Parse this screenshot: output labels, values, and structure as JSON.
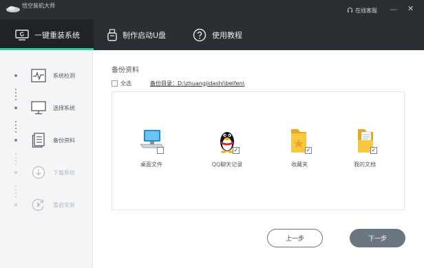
{
  "app": {
    "title": "悟空装机大师",
    "online_help": "在线客服"
  },
  "window": {
    "minimize_glyph": "—",
    "close_glyph": "✕"
  },
  "topnav": {
    "tabs": [
      {
        "label": "一键重装系统",
        "icon": "monitor-icon",
        "active": true
      },
      {
        "label": "制作启动U盘",
        "icon": "usb-drive-icon",
        "active": false
      },
      {
        "label": "使用教程",
        "icon": "question-circle-icon",
        "active": false
      }
    ]
  },
  "sidebar": {
    "steps": [
      {
        "label": "系统检测",
        "icon": "pulse-monitor-icon",
        "state": "done"
      },
      {
        "label": "选择系统",
        "icon": "desktop-icon",
        "state": "done"
      },
      {
        "label": "备份资料",
        "icon": "document-icon",
        "state": "done"
      },
      {
        "label": "下载系统",
        "icon": "download-icon",
        "state": "todo"
      },
      {
        "label": "重启安装",
        "icon": "restart-icon",
        "state": "todo"
      }
    ]
  },
  "main": {
    "section_title": "备份资料",
    "select_all": {
      "label": "全选",
      "checked": false
    },
    "backup_dir": "备份目录：D:\\zhuangjidashi\\beifen\\",
    "items": [
      {
        "label": "桌面文件",
        "icon": "desktop-computer-icon",
        "checked": false
      },
      {
        "label": "QQ聊天记录",
        "icon": "qq-penguin-icon",
        "checked": true
      },
      {
        "label": "收藏夹",
        "icon": "favorites-folder-icon",
        "checked": true
      },
      {
        "label": "我的文档",
        "icon": "documents-folder-icon",
        "checked": true
      }
    ],
    "checkmark": "✓"
  },
  "buttons": {
    "prev": "上一步",
    "next": "下一步"
  },
  "colors": {
    "header_bg": "#2b2f33",
    "accent": "#2fc8a4",
    "next_button": "#6b7680",
    "sidebar_bg": "#f4f5f6"
  }
}
